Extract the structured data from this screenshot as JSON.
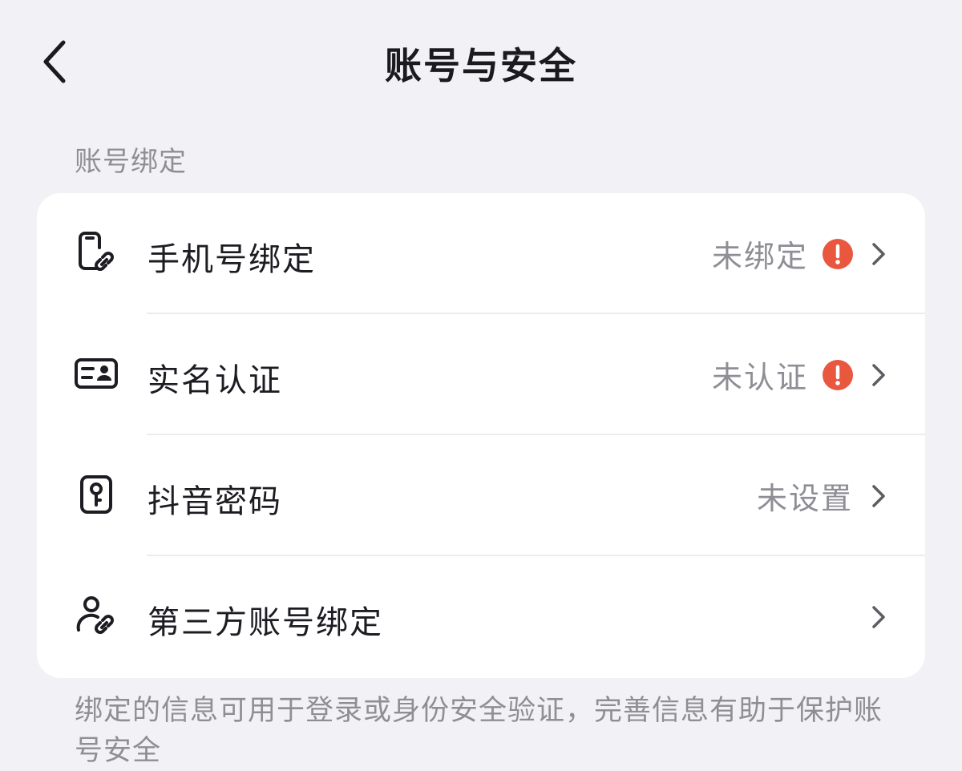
{
  "header": {
    "title": "账号与安全",
    "back_icon": "chevron-left-icon"
  },
  "section": {
    "title": "账号绑定"
  },
  "rows": [
    {
      "icon": "phone-link-icon",
      "label": "手机号绑定",
      "status": "未绑定",
      "warning": true
    },
    {
      "icon": "id-card-icon",
      "label": "实名认证",
      "status": "未认证",
      "warning": true
    },
    {
      "icon": "key-lock-icon",
      "label": "抖音密码",
      "status": "未设置",
      "warning": false
    },
    {
      "icon": "user-link-icon",
      "label": "第三方账号绑定",
      "status": "",
      "warning": false
    }
  ],
  "footer": {
    "note": "绑定的信息可用于登录或身份安全验证，完善信息有助于保护账号安全"
  },
  "colors": {
    "background": "#f2f2f6",
    "card": "#ffffff",
    "warning": "#e9573f",
    "secondary_text": "#8e8e95"
  }
}
